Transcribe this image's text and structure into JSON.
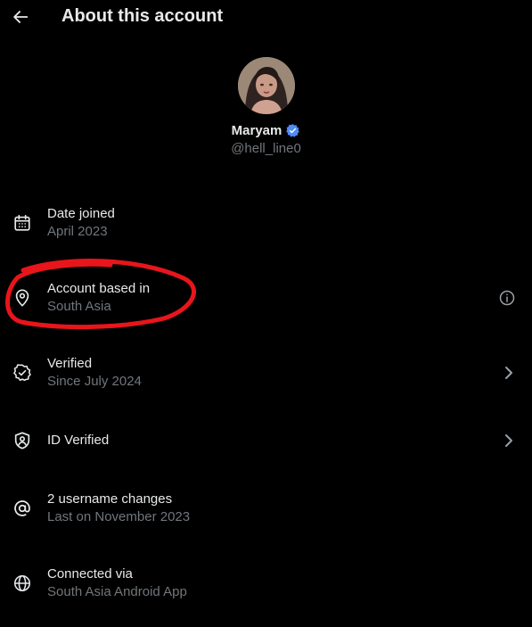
{
  "header": {
    "title": "About this account",
    "back_icon": "arrow-left-icon"
  },
  "profile": {
    "name": "Maryam",
    "handle": "@hell_line0",
    "badge_color": "#4f8cf7"
  },
  "items": [
    {
      "label": "Date joined",
      "value": "April 2023",
      "icon": "calendar-icon"
    },
    {
      "label": "Account based in",
      "value": "South Asia",
      "icon": "location-pin-icon",
      "right_icon": "info-icon"
    },
    {
      "label": "Verified",
      "value": "Since July 2024",
      "icon": "verified-badge-icon",
      "right_icon": "chevron-right-icon"
    },
    {
      "label": "ID Verified",
      "value": "",
      "icon": "id-shield-icon",
      "right_icon": "chevron-right-icon"
    },
    {
      "label": "2 username changes",
      "value": "Last on November 2023",
      "icon": "at-sign-icon"
    },
    {
      "label": "Connected via",
      "value": "South Asia Android App",
      "icon": "globe-icon"
    }
  ],
  "annotation": {
    "color": "#e8151b"
  }
}
